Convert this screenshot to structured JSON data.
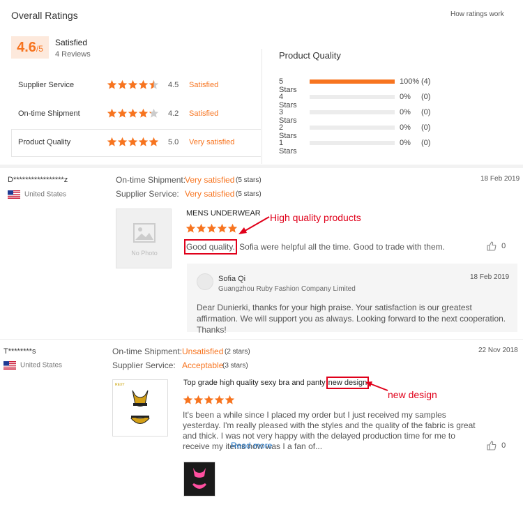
{
  "overall": {
    "title": "Overall Ratings",
    "how_link": "How ratings work",
    "score": "4.6",
    "score_suffix": "/5",
    "label": "Satisfied",
    "reviews": "4 Reviews",
    "rows": [
      {
        "label": "Supplier Service",
        "value": "4.5",
        "text": "Satisfied",
        "stars": 4.5
      },
      {
        "label": "On-time Shipment",
        "value": "4.2",
        "text": "Satisfied",
        "stars": 4.2
      },
      {
        "label": "Product Quality",
        "value": "5.0",
        "text": "Very satisfied",
        "stars": 5
      }
    ]
  },
  "product_quality": {
    "title": "Product Quality",
    "bars": [
      {
        "label": "5 Stars",
        "fill": 1.0,
        "pct": "100%",
        "count": "(4)"
      },
      {
        "label": "4 Stars",
        "fill": 0,
        "pct": "0%",
        "count": "(0)"
      },
      {
        "label": "3 Stars",
        "fill": 0,
        "pct": "0%",
        "count": "(0)"
      },
      {
        "label": "2 Stars",
        "fill": 0,
        "pct": "0%",
        "count": "(0)"
      },
      {
        "label": "1 Stars",
        "fill": 0,
        "pct": "0%",
        "count": "(0)"
      }
    ]
  },
  "reviews": [
    {
      "name": "D*****************z",
      "country": "United States",
      "date": "18 Feb 2019",
      "shipment_label": "On-time Shipment:",
      "shipment_value": "Very satisfied",
      "shipment_stars": "(5 stars)",
      "service_label": "Supplier Service:",
      "service_value": "Very satisfied",
      "service_stars": "(5 stars)",
      "no_photo": "No Photo",
      "product": "MENS UNDERWEAR",
      "rating": 5,
      "text_highlight": "Good quality.",
      "text_rest": " Sofia were helpful all the time. Good to trade with them.",
      "likes": "0",
      "reply": {
        "name": "Sofia Qi",
        "company": "Guangzhou Ruby Fashion Company Limited",
        "date": "18 Feb 2019",
        "text": "Dear Dunierki, thanks for your high praise. Your satisfaction is our greatest affirmation. We will support you as always. Looking forward to the next cooperation. Thanks!"
      }
    },
    {
      "name": "T********s",
      "country": "United States",
      "date": "22 Nov 2018",
      "shipment_label": "On-time Shipment:",
      "shipment_value": "Unsatisfied",
      "shipment_stars": "(2 stars)",
      "service_label": "Supplier Service:",
      "service_value": "Acceptable",
      "service_stars": "(3 stars)",
      "product": "Top grade high quality sexy bra and panty",
      "product_highlight": "new design",
      "rating": 5,
      "text": "It's been a while since I placed my order but I just received my samples yesterday. I'm really pleased with the styles and the quality of the fabric is great and thick. I was not very happy with the delayed production time for me to receive my items now was I a fan of...",
      "read_more": "Read more",
      "likes": "0"
    }
  ],
  "annotations": {
    "high_quality": "High quality products",
    "new_design": "new design"
  },
  "colors": {
    "accent": "#f7741f",
    "annotation": "#e0001a",
    "link": "#1a73c8"
  }
}
